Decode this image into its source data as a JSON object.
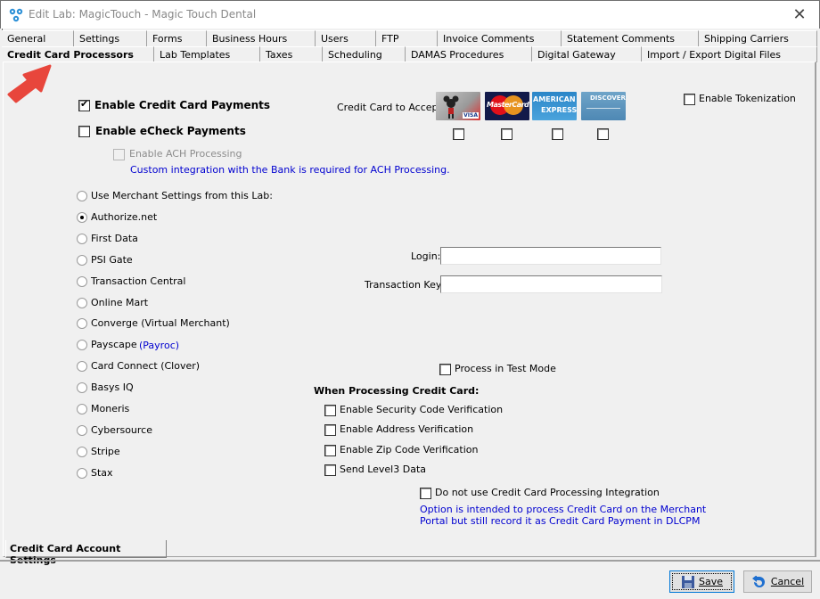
{
  "window": {
    "title": "Edit Lab: MagicTouch - Magic Touch Dental",
    "close_icon": "close-icon",
    "app_icon": "molecule-app-icon"
  },
  "tabs": {
    "row1": [
      {
        "label": "General"
      },
      {
        "label": "Settings"
      },
      {
        "label": "Forms"
      },
      {
        "label": "Business Hours"
      },
      {
        "label": "Users"
      },
      {
        "label": "FTP"
      },
      {
        "label": "Invoice Comments"
      },
      {
        "label": "Statement Comments"
      },
      {
        "label": "Shipping Carriers"
      }
    ],
    "row2": [
      {
        "label": "Credit Card Processors",
        "active": true
      },
      {
        "label": "Lab Templates"
      },
      {
        "label": "Taxes"
      },
      {
        "label": "Scheduling"
      },
      {
        "label": "DAMAS Procedures"
      },
      {
        "label": "Digital Gateway"
      },
      {
        "label": "Import / Export Digital Files"
      }
    ]
  },
  "annotation": {
    "arrow_color": "#e8463c"
  },
  "payments": {
    "enable_cc": {
      "label": "Enable Credit Card Payments",
      "checked": true
    },
    "enable_echeck": {
      "label": "Enable eCheck Payments",
      "checked": false
    },
    "enable_ach": {
      "label": "Enable ACH Processing",
      "checked": false,
      "disabled": true
    },
    "ach_note": "Custom integration with the Bank is required for ACH Processing."
  },
  "cards": {
    "label": "Credit Card to Accept:",
    "items": [
      {
        "name": "Visa",
        "checked": false
      },
      {
        "name": "MasterCard",
        "checked": false
      },
      {
        "name": "American Express",
        "checked": false
      },
      {
        "name": "Discover",
        "checked": false
      }
    ],
    "mc_text": "MasterCard",
    "amex_text1": "AMERICAN",
    "amex_text2": "EXPRESS",
    "discover_text": "DISCOVER",
    "visa_text": "VISA"
  },
  "tokenization": {
    "label": "Enable Tokenization",
    "checked": false
  },
  "processors": {
    "selected": "Authorize.net",
    "items": [
      {
        "label": "Use Merchant Settings from this Lab:"
      },
      {
        "label": "Authorize.net"
      },
      {
        "label": "First Data"
      },
      {
        "label": "PSI Gate"
      },
      {
        "label": "Transaction Central"
      },
      {
        "label": "Online Mart"
      },
      {
        "label": "Converge (Virtual Merchant)"
      },
      {
        "label": "Payscape",
        "note": "(Payroc)"
      },
      {
        "label": "Card Connect (Clover)"
      },
      {
        "label": "Basys IQ"
      },
      {
        "label": "Moneris"
      },
      {
        "label": "Cybersource"
      },
      {
        "label": "Stripe"
      },
      {
        "label": "Stax"
      }
    ]
  },
  "credentials": {
    "login_label": "Login:",
    "login_value": "",
    "key_label": "Transaction Key:",
    "key_value": ""
  },
  "test_mode": {
    "label": "Process in Test Mode",
    "checked": false
  },
  "when_processing": {
    "heading": "When Processing Credit Card:",
    "items": [
      {
        "label": "Enable Security Code Verification",
        "checked": false
      },
      {
        "label": "Enable Address Verification",
        "checked": false
      },
      {
        "label": "Enable Zip Code Verification",
        "checked": false
      },
      {
        "label": "Send Level3 Data",
        "checked": false
      }
    ]
  },
  "no_integration": {
    "label": "Do not use Credit Card Processing Integration",
    "checked": false,
    "note_line1": "Option is intended to process Credit Card on the Merchant",
    "note_line2": "Portal but still record it as Credit Card Payment in DLCPM"
  },
  "bottom_tab": {
    "label": "Credit Card Account Settings"
  },
  "footer": {
    "save_label": "Save",
    "cancel_label": "Cancel"
  }
}
